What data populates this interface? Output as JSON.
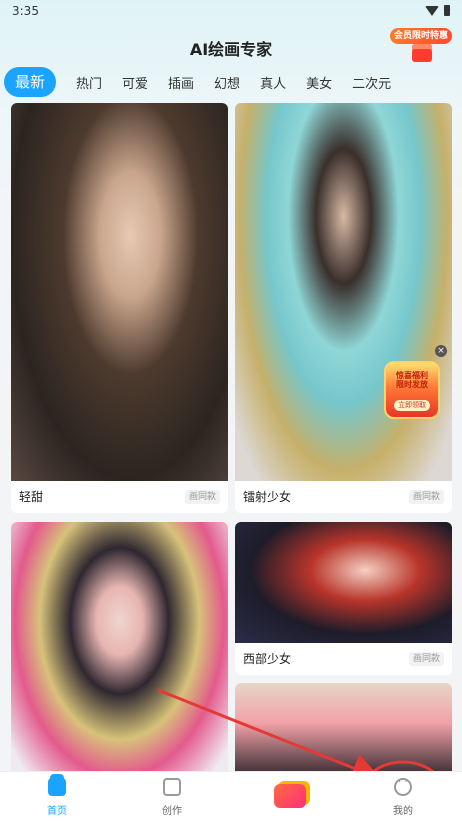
{
  "status_bar": {
    "time": "3:35"
  },
  "header": {
    "title": "AI绘画专家",
    "promo_label": "会员限时特惠"
  },
  "tabs": [
    {
      "label": "最新",
      "active": true
    },
    {
      "label": "热门",
      "active": false
    },
    {
      "label": "可爱",
      "active": false
    },
    {
      "label": "插画",
      "active": false
    },
    {
      "label": "幻想",
      "active": false
    },
    {
      "label": "真人",
      "active": false
    },
    {
      "label": "美女",
      "active": false
    },
    {
      "label": "二次元",
      "active": false
    }
  ],
  "cards": [
    {
      "caption": "轻甜",
      "tag": "画同款"
    },
    {
      "caption": "镭射少女",
      "tag": "画同款"
    },
    {
      "caption": "",
      "tag": ""
    },
    {
      "caption": "西部少女",
      "tag": "画同款"
    },
    {
      "caption": "",
      "tag": ""
    }
  ],
  "floating_ad": {
    "title": "惊喜福利\n限时发放",
    "button": "立即领取"
  },
  "bottom_nav": [
    {
      "label": "首页",
      "active": true,
      "icon": "home-icon"
    },
    {
      "label": "创作",
      "active": false,
      "icon": "create-icon"
    },
    {
      "label": "",
      "active": false,
      "icon": "gift-icon"
    },
    {
      "label": "我的",
      "active": false,
      "icon": "profile-icon"
    }
  ],
  "colors": {
    "accent": "#1aa3ff",
    "annotation": "#e53935"
  }
}
